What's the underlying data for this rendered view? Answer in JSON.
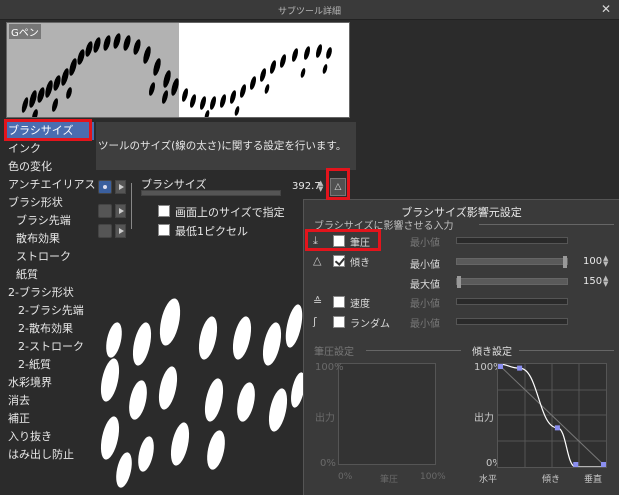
{
  "window": {
    "title": "サブツール詳細"
  },
  "preview": {
    "brush_name": "Gペン"
  },
  "sidebar": {
    "items": [
      {
        "label": "ブラシサイズ"
      },
      {
        "label": "インク"
      },
      {
        "label": "色の変化"
      },
      {
        "label": "アンチエイリアス"
      },
      {
        "label": "ブラシ形状"
      },
      {
        "label": "ブラシ先端"
      },
      {
        "label": "散布効果"
      },
      {
        "label": "ストローク"
      },
      {
        "label": "紙質"
      },
      {
        "label": "2-ブラシ形状"
      },
      {
        "label": "2-ブラシ先端"
      },
      {
        "label": "2-散布効果"
      },
      {
        "label": "2-ストローク"
      },
      {
        "label": "2-紙質"
      },
      {
        "label": "水彩境界"
      },
      {
        "label": "消去"
      },
      {
        "label": "補正"
      },
      {
        "label": "入り抜き"
      },
      {
        "label": "はみ出し防止"
      }
    ]
  },
  "description": "ツールのサイズ(線の太さ)に関する設定を行います。",
  "brush_size": {
    "label": "ブラシサイズ",
    "value": "392.7",
    "level": 0.0
  },
  "options": {
    "screen_size": "画面上のサイズで指定",
    "min_1px": "最低1ピクセル"
  },
  "popup": {
    "title": "ブラシサイズ影響元設定",
    "group_label": "ブラシサイズに影響させる入力",
    "sources": [
      {
        "label": "筆圧",
        "checked": false,
        "icon": "pen-pressure-icon"
      },
      {
        "label": "傾き",
        "checked": true,
        "icon": "tilt-icon"
      },
      {
        "label": "速度",
        "checked": false,
        "icon": "velocity-icon"
      },
      {
        "label": "ランダム",
        "checked": false,
        "icon": "random-icon"
      }
    ],
    "min_label": "最小値",
    "max_label": "最大値",
    "tilt_min_value": "100",
    "tilt_max_value": "150",
    "tilt_min_level": 1.0,
    "tilt_max_level": 0.0,
    "pressure_graph": {
      "label": "筆圧設定",
      "y_top": "100%",
      "y_mid": "出力",
      "y_bottom": "0%",
      "x_left": "0%",
      "x_mid": "筆圧",
      "x_right": "100%"
    },
    "tilt_graph": {
      "label": "傾き設定",
      "y_top": "100%",
      "y_mid": "出力",
      "y_bottom": "0%",
      "x_left": "水平",
      "x_mid": "傾き",
      "x_right": "垂直",
      "control_points": [
        [
          0,
          1.0
        ],
        [
          0.2,
          0.96
        ],
        [
          0.55,
          0.38
        ],
        [
          0.72,
          0.0
        ],
        [
          1.0,
          0.0
        ]
      ]
    }
  },
  "colors": {
    "accent": "#4a6db0",
    "highlight": "#e3141c",
    "curve_point": "#8b8ff0"
  }
}
